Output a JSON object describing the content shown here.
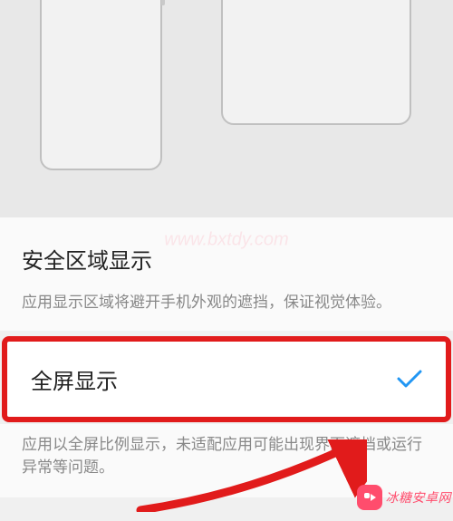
{
  "safeArea": {
    "title": "安全区域显示",
    "description": "应用显示区域将避开手机外观的遮挡，保证视觉体验。"
  },
  "fullscreen": {
    "label": "全屏显示",
    "selected": true,
    "description": "应用以全屏比例显示，未适配应用可能出现界面遮挡或运行异常等问题。"
  },
  "annotation": {
    "highlightColor": "#e11b1b",
    "checkColor": "#2196f3"
  },
  "watermark": {
    "text": "冰糖安卓网",
    "url": "www.bxtdy.com"
  }
}
